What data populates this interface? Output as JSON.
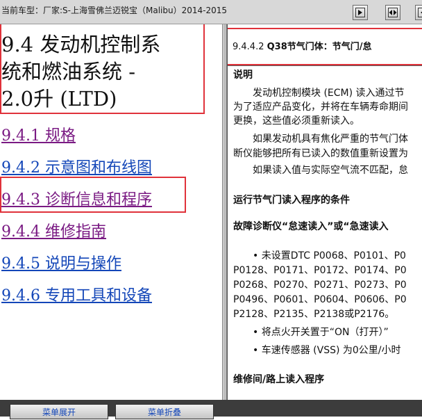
{
  "window": {
    "title": "当前车型：厂家:S-上海雪佛兰迈锐宝（Malibu）2014-2015"
  },
  "toolbar": {
    "buttons": [
      {
        "icon": "pane-arrow-right-icon"
      },
      {
        "icon": "pane-arrows-split-icon"
      },
      {
        "icon": "pane-arrow-left-icon"
      }
    ]
  },
  "left": {
    "title_lines": [
      "9.4 发动机控制系",
      "统和燃油系统 -",
      "2.0升 (LTD)"
    ],
    "toc": [
      {
        "label": "9.4.1 规格",
        "visited": true
      },
      {
        "label": "9.4.2 示意图和布线图",
        "visited": false
      },
      {
        "label": "9.4.3 诊断信息和程序",
        "visited": true
      },
      {
        "label": "9.4.4 维修指南",
        "visited": true
      },
      {
        "label": "9.4.5 说明与操作",
        "visited": false
      },
      {
        "label": "9.4.6 专用工具和设备",
        "visited": false
      }
    ]
  },
  "right": {
    "section_number": "9.4.4.2",
    "section_title": "Q38节气门体：节气门/怠",
    "lines": [
      {
        "text": "说明",
        "bold": true
      },
      {
        "text": "　　发动机控制模块 (ECM) 读入通过节",
        "bold": false
      },
      {
        "text": "为了适应产品变化，并将在车辆寿命期间",
        "bold": false
      },
      {
        "text": "更换，这些值必须重新读入。",
        "bold": false
      },
      {
        "text": "　　如果发动机具有焦化严重的节气门体",
        "bold": false
      },
      {
        "text": "断仪能够把所有已读入的数值重新设置为",
        "bold": false
      },
      {
        "text": "　　如果读入值与实际空气流不匹配，怠",
        "bold": false
      },
      {
        "text": "运行节气门读入程序的条件",
        "bold": true
      },
      {
        "text": "故障诊断仪“怠速读入”或“急速读入",
        "bold": true
      },
      {
        "text": "　　• 未设置DTC P0068、P0101、P0",
        "bold": false
      },
      {
        "text": "P0128、P0171、P0172、P0174、P0",
        "bold": false
      },
      {
        "text": "P0268、P0270、P0271、P0273、P0",
        "bold": false
      },
      {
        "text": "P0496、P0601、P0604、P0606、P0",
        "bold": false
      },
      {
        "text": "P2128、P2135、P2138或P2176。",
        "bold": false
      },
      {
        "text": "　　• 将点火开关置于“ON（打开）”",
        "bold": false
      },
      {
        "text": "　　• 车速传感器 (VSS) 为0公里/小时",
        "bold": false
      },
      {
        "text": "维修间/路上读入程序",
        "bold": true
      }
    ]
  },
  "bottom": {
    "expand_label": "菜单展开",
    "collapse_label": "菜单折叠"
  },
  "colors": {
    "link": "#1346b8",
    "visited": "#7a1a83",
    "highlight": "#e0323a"
  }
}
